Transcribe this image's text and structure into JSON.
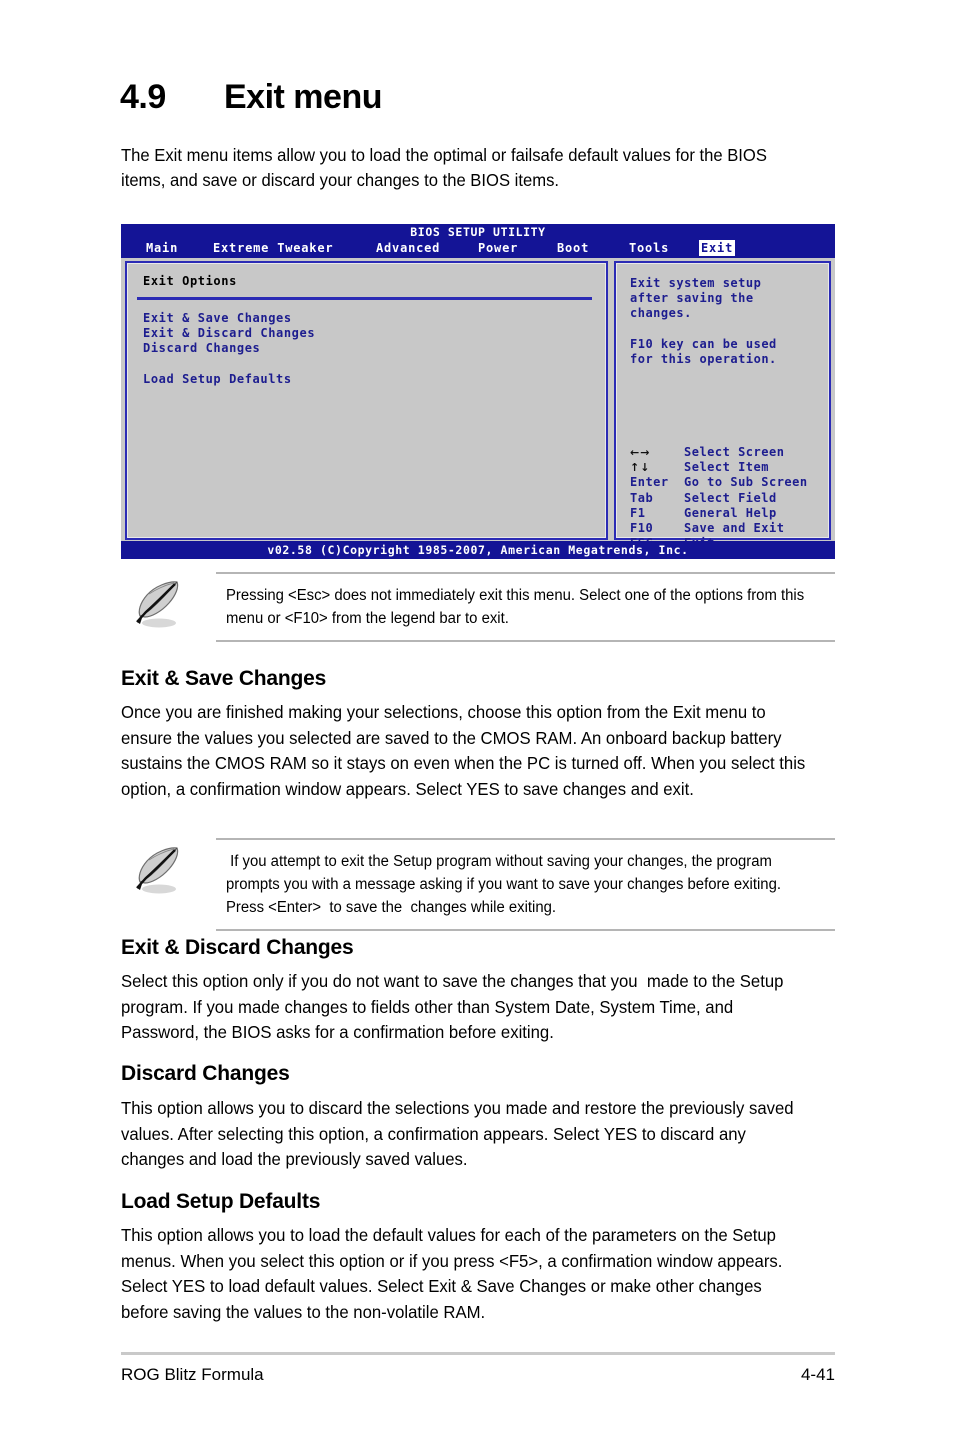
{
  "section": {
    "number": "4.9",
    "title": "Exit menu",
    "intro": "The Exit menu items allow you to load the optimal or failsafe default values for the BIOS items, and save or discard your changes to the BIOS items."
  },
  "bios": {
    "title": "BIOS SETUP UTILITY",
    "tabs": [
      {
        "label": "Main",
        "selected": false
      },
      {
        "label": "Extreme Tweaker",
        "selected": false
      },
      {
        "label": "Advanced",
        "selected": false
      },
      {
        "label": "Power",
        "selected": false
      },
      {
        "label": "Boot",
        "selected": false
      },
      {
        "label": "Tools",
        "selected": false
      },
      {
        "label": "Exit",
        "selected": true
      }
    ],
    "panel_heading": "Exit Options",
    "options": [
      "Exit & Save Changes",
      "Exit & Discard Changes",
      "Discard Changes"
    ],
    "options_group2": [
      "Load Setup Defaults"
    ],
    "help": {
      "line1": "Exit system setup\nafter saving the\nchanges.",
      "line2": "F10 key can be used\nfor this operation."
    },
    "legend": [
      {
        "key": "←→",
        "glyph": true,
        "desc": "Select Screen"
      },
      {
        "key": "↑↓",
        "glyph": true,
        "desc": "Select Item"
      },
      {
        "key": "Enter",
        "glyph": false,
        "desc": "Go to Sub Screen"
      },
      {
        "key": "Tab",
        "glyph": false,
        "desc": "Select Field"
      },
      {
        "key": "F1",
        "glyph": false,
        "desc": "General Help"
      },
      {
        "key": "F10",
        "glyph": false,
        "desc": "Save and Exit"
      },
      {
        "key": "ESC",
        "glyph": false,
        "desc": "Exit"
      }
    ],
    "footer": "v02.58 (C)Copyright 1985-2007, American Megatrends, Inc.",
    "colors": {
      "header_bg": "#141496",
      "panel_bg": "#c8c8c8",
      "border": "#2b2bb5",
      "option_text": "#1d1d8f",
      "tab_selected_bg": "#ffffff"
    }
  },
  "notes": {
    "note1": "Pressing <Esc> does not immediately exit this menu. Select one of the options from this menu or <F10> from the legend bar to exit.",
    "note2": " If you attempt to exit the Setup program without saving your changes, the program prompts you with a message asking if you want to save your changes before exiting. Press <Enter>  to save the  changes while exiting."
  },
  "sections": [
    {
      "heading": "Exit & Save Changes",
      "body": "Once you are finished making your selections, choose this option from the Exit menu to ensure the values you selected are saved to the CMOS RAM. An onboard backup battery sustains the CMOS RAM so it stays on even when the PC is turned off. When you select this option, a confirmation window appears. Select YES to save changes and exit."
    },
    {
      "heading": "Exit & Discard Changes",
      "body": "Select this option only if you do not want to save the changes that you  made to the Setup program. If you made changes to fields other than System Date, System Time, and Password, the BIOS asks for a confirmation before exiting."
    },
    {
      "heading": "Discard Changes",
      "body": "This option allows you to discard the selections you made and restore the previously saved values. After selecting this option, a confirmation appears. Select YES to discard any changes and load the previously saved values."
    },
    {
      "heading": "Load Setup Defaults",
      "body": "This option allows you to load the default values for each of the parameters on the Setup menus. When you select this option or if you press <F5>, a confirmation window appears. Select YES to load default values. Select Exit & Save Changes or make other changes before saving the values to the non-volatile RAM."
    }
  ],
  "footer": {
    "left": "ROG Blitz Formula",
    "page": "4-41"
  }
}
